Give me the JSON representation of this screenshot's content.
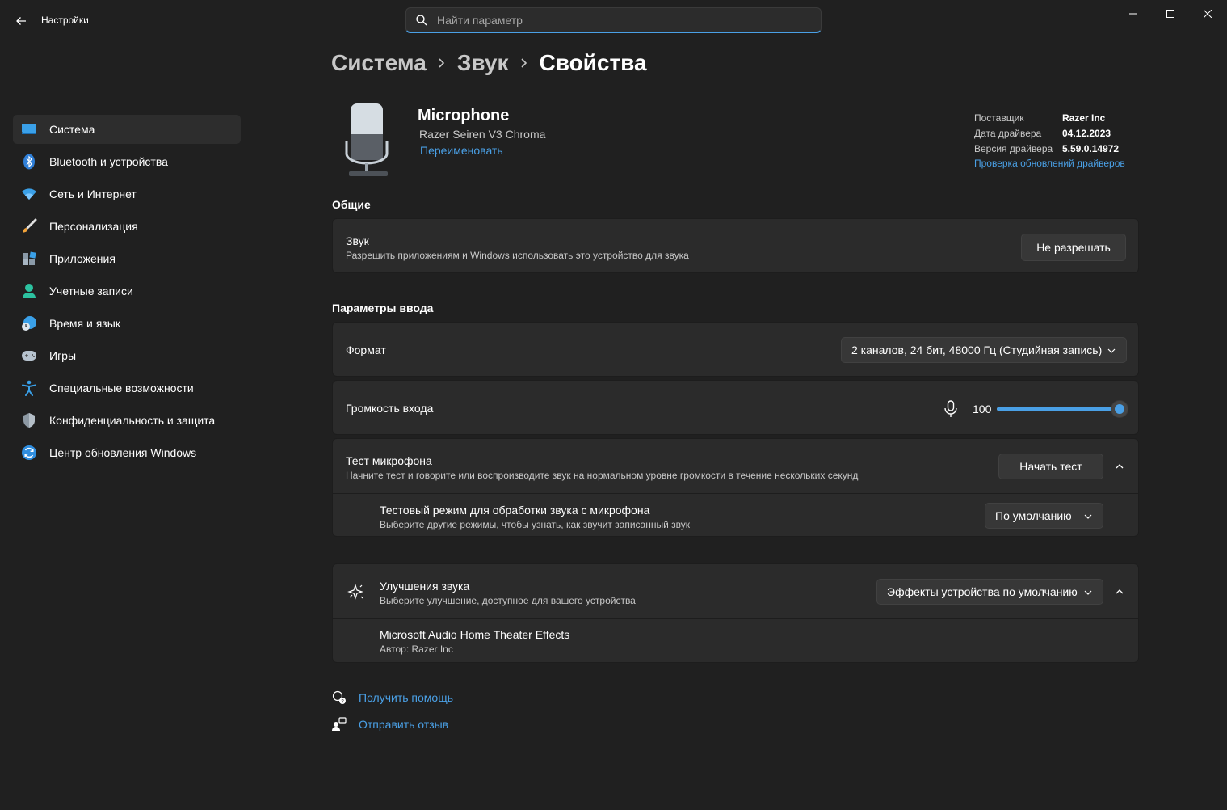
{
  "app": {
    "title": "Настройки"
  },
  "search": {
    "placeholder": "Найти параметр"
  },
  "sidebar": {
    "items": [
      {
        "label": "Система",
        "icon": "system-icon",
        "active": true
      },
      {
        "label": "Bluetooth и устройства",
        "icon": "bluetooth-icon"
      },
      {
        "label": "Сеть и Интернет",
        "icon": "wifi-icon"
      },
      {
        "label": "Персонализация",
        "icon": "brush-icon"
      },
      {
        "label": "Приложения",
        "icon": "apps-icon"
      },
      {
        "label": "Учетные записи",
        "icon": "account-icon"
      },
      {
        "label": "Время и язык",
        "icon": "time-language-icon"
      },
      {
        "label": "Игры",
        "icon": "gamepad-icon"
      },
      {
        "label": "Специальные возможности",
        "icon": "accessibility-icon"
      },
      {
        "label": "Конфиденциальность и защита",
        "icon": "shield-icon"
      },
      {
        "label": "Центр обновления Windows",
        "icon": "update-icon"
      }
    ]
  },
  "breadcrumb": {
    "items": [
      "Система",
      "Звук",
      "Свойства"
    ]
  },
  "device": {
    "name": "Microphone",
    "model": "Razer Seiren V3 Chroma",
    "rename": "Переименовать",
    "info": [
      {
        "key": "Поставщик",
        "value": "Razer Inc"
      },
      {
        "key": "Дата драйвера",
        "value": "04.12.2023"
      },
      {
        "key": "Версия драйвера",
        "value": "5.59.0.14972"
      }
    ],
    "check_updates": "Проверка обновлений драйверов"
  },
  "general": {
    "title": "Общие",
    "audio": {
      "title": "Звук",
      "subtitle": "Разрешить приложениям и Windows использовать это устройство для звука",
      "button": "Не разрешать"
    }
  },
  "input": {
    "title": "Параметры ввода",
    "format": {
      "label": "Формат",
      "value": "2 каналов, 24 бит, 48000 Гц (Студийная запись)"
    },
    "volume": {
      "label": "Громкость входа",
      "value": "100",
      "level": 100
    },
    "mic_test": {
      "title": "Тест микрофона",
      "subtitle": "Начните тест и говорите или воспроизводите звук на нормальном уровне громкости в течение нескольких секунд",
      "button": "Начать тест",
      "mode": {
        "title": "Тестовый режим для обработки звука с микрофона",
        "subtitle": "Выберите другие режимы, чтобы узнать, как звучит записанный звук",
        "value": "По умолчанию"
      }
    }
  },
  "enhancements": {
    "title": "Улучшения звука",
    "subtitle": "Выберите улучшение, доступное для вашего устройства",
    "value": "Эффекты устройства по умолчанию",
    "effect": {
      "title": "Microsoft Audio Home Theater Effects",
      "subtitle": "Автор: Razer Inc"
    }
  },
  "help": {
    "get_help": "Получить помощь",
    "feedback": "Отправить отзыв"
  },
  "colors": {
    "accent": "#4aa0e6",
    "background": "#202020",
    "card": "#2b2b2b"
  }
}
